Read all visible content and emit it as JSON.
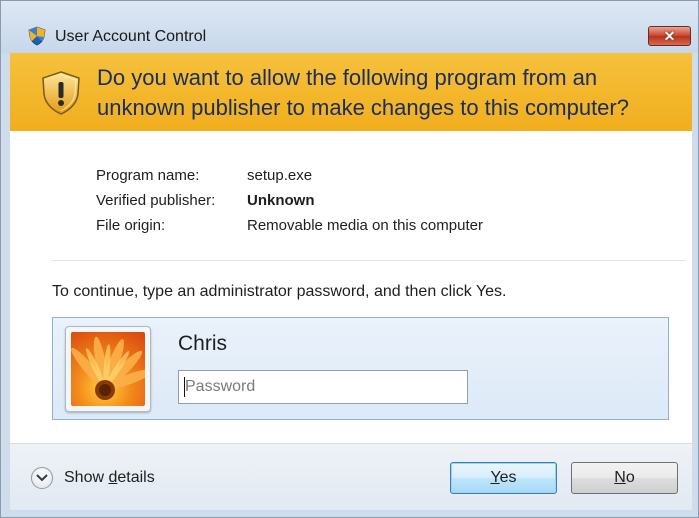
{
  "window": {
    "title": "User Account Control",
    "close_glyph": "✕"
  },
  "banner": {
    "heading": "Do you want to allow the following program from an unknown publisher to make changes to this computer?",
    "icon": "uac-shield-warning-icon"
  },
  "program_info": [
    {
      "label": "Program name:",
      "value": "setup.exe",
      "bold": false
    },
    {
      "label": "Verified publisher:",
      "value": "Unknown",
      "bold": true
    },
    {
      "label": "File origin:",
      "value": "Removable media on this computer",
      "bold": false
    }
  ],
  "credentials": {
    "prompt": "To continue, type an administrator password, and then click Yes.",
    "username": "Chris",
    "password_placeholder": "Password",
    "password_value": "",
    "avatar": "flower-avatar"
  },
  "footer": {
    "details_prefix": "Show ",
    "details_underlined": "d",
    "details_suffix": "etails",
    "yes_underlined": "Y",
    "yes_suffix": "es",
    "no_underlined": "N",
    "no_suffix": "o"
  },
  "colors": {
    "banner": "#f3b529",
    "heading_text": "#1b2e62",
    "titlebar": "#d3e0ef",
    "close_button": "#c9472f",
    "credential_panel": "#e3edf8",
    "yes_button_border": "#3c7fb1"
  }
}
